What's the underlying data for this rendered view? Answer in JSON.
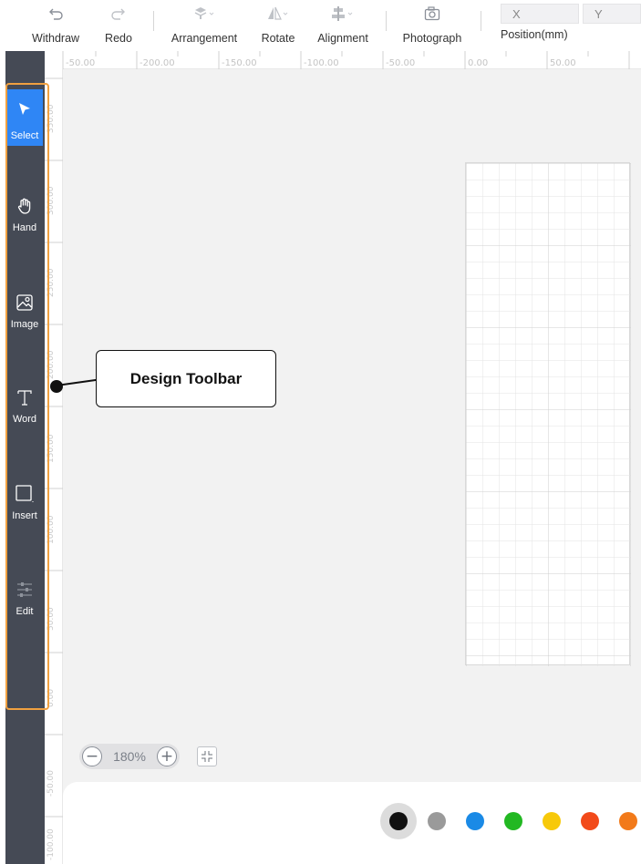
{
  "toolbar": {
    "withdraw": "Withdraw",
    "redo": "Redo",
    "arrangement": "Arrangement",
    "rotate": "Rotate",
    "alignment": "Alignment",
    "photograph": "Photograph",
    "position_x": "X",
    "position_y": "Y",
    "position_label": "Position(mm)"
  },
  "sidebar": {
    "items": [
      {
        "label": "Select",
        "icon": "cursor-icon",
        "active": true
      },
      {
        "label": "Hand",
        "icon": "hand-icon"
      },
      {
        "label": "Image",
        "icon": "image-icon"
      },
      {
        "label": "Word",
        "icon": "text-icon"
      },
      {
        "label": "Insert",
        "icon": "shape-icon"
      },
      {
        "label": "Edit",
        "icon": "sliders-icon"
      }
    ]
  },
  "ruler": {
    "top": [
      "-50.00",
      "-200.00",
      "-150.00",
      "-100.00",
      "-50.00",
      "0.00",
      "50.00"
    ],
    "left": [
      "350.00",
      "300.00",
      "250.00",
      "200.00",
      "150.00",
      "100.00",
      "50.00",
      "0.00",
      "-50.00",
      "-100.00"
    ]
  },
  "zoom": {
    "value": "180%",
    "minus": "−",
    "plus": "+"
  },
  "callout": {
    "label": "Design Toolbar"
  },
  "colors": {
    "swatches": [
      "#111111",
      "#9a9a9a",
      "#1a8ae6",
      "#22b822",
      "#f7c90a",
      "#f24a1a",
      "#f27a1a"
    ],
    "selected": "#111111",
    "highlight": "#f0a040",
    "sidebar_active": "#2f86f5"
  }
}
